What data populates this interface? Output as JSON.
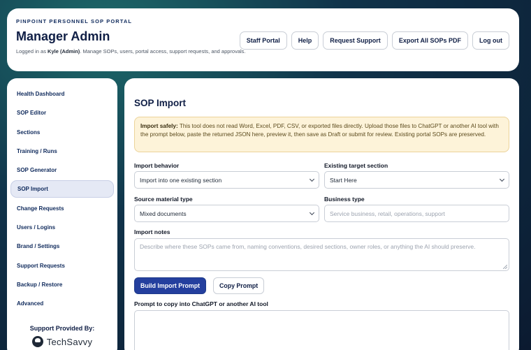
{
  "header": {
    "eyebrow": "PINPOINT PERSONNEL SOP PORTAL",
    "title": "Manager Admin",
    "subtitle_prefix": "Logged in as ",
    "user": "Kyle (Admin)",
    "subtitle_suffix": ". Manage SOPs, users, portal access, support requests, and approvals.",
    "buttons": {
      "staff_portal": "Staff Portal",
      "help": "Help",
      "request_support": "Request Support",
      "export_pdf": "Export All SOPs PDF",
      "logout": "Log out"
    }
  },
  "sidebar": {
    "items": [
      {
        "label": "Health Dashboard"
      },
      {
        "label": "SOP Editor"
      },
      {
        "label": "Sections"
      },
      {
        "label": "Training / Runs"
      },
      {
        "label": "SOP Generator"
      },
      {
        "label": "SOP Import"
      },
      {
        "label": "Change Requests"
      },
      {
        "label": "Users / Logins"
      },
      {
        "label": "Brand / Settings"
      },
      {
        "label": "Support Requests"
      },
      {
        "label": "Backup / Restore"
      },
      {
        "label": "Advanced"
      }
    ],
    "active_index": 5,
    "support_label": "Support Provided By:",
    "logo_text": "TechSavvy"
  },
  "main": {
    "title": "SOP Import",
    "notice_strong": "Import safely:",
    "notice_text": " This tool does not read Word, Excel, PDF, CSV, or exported files directly. Upload those files to ChatGPT or another AI tool with the prompt below, paste the returned JSON here, preview it, then save as Draft or submit for review. Existing portal SOPs are preserved.",
    "import_behavior": {
      "label": "Import behavior",
      "value": "Import into one existing section"
    },
    "target_section": {
      "label": "Existing target section",
      "value": "Start Here"
    },
    "source_type": {
      "label": "Source material type",
      "value": "Mixed documents"
    },
    "business_type": {
      "label": "Business type",
      "placeholder": "Service business, retail, operations, support"
    },
    "import_notes": {
      "label": "Import notes",
      "placeholder": "Describe where these SOPs came from, naming conventions, desired sections, owner roles, or anything the AI should preserve."
    },
    "build_button": "Build Import Prompt",
    "copy_button": "Copy Prompt",
    "prompt_label": "Prompt to copy into ChatGPT or another AI tool"
  },
  "colors": {
    "primary": "#243f9e",
    "notice_bg": "#fdf3d9",
    "navy": "#0f1e45"
  }
}
